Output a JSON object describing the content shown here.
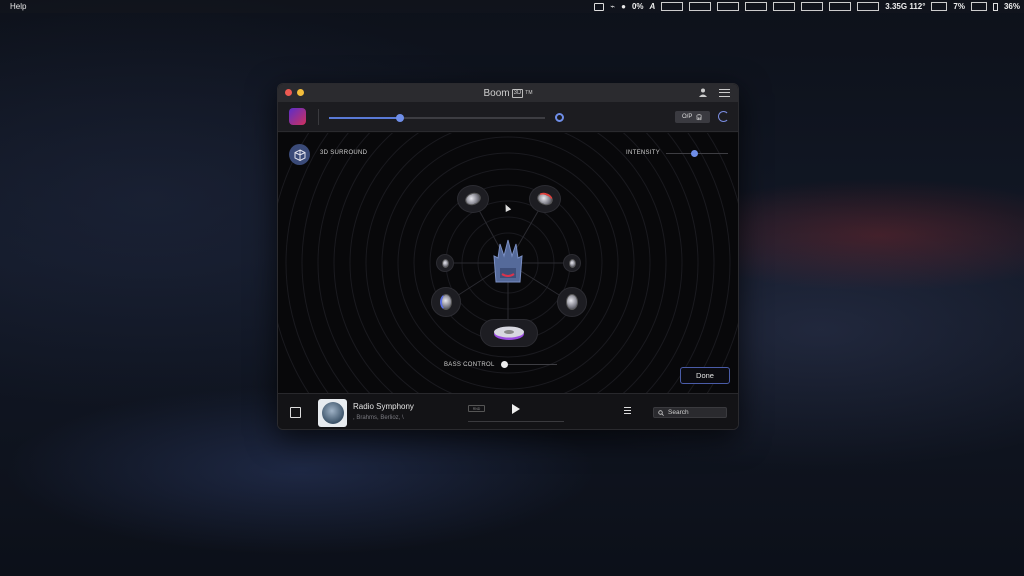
{
  "menubar": {
    "app_menu": "Help",
    "battery_label": "0%",
    "input_source": "A",
    "cpu_freq": "3.35G 112°",
    "cpu_usage": "7%",
    "battery_percent": "36%"
  },
  "window": {
    "title": "Boom",
    "title_badge": "3D",
    "trademark": "TM"
  },
  "toolbar": {
    "volume_level": 0.33,
    "output_button": "O/P"
  },
  "main": {
    "surround_label": "3D SURROUND",
    "intensity_label": "INTENSITY",
    "intensity_level": 0.45,
    "bass_label": "BASS CONTROL",
    "bass_level": 0.0,
    "done_button": "Done"
  },
  "player": {
    "track_title": "Radio Symphony",
    "track_artist": ", Brahms, Berlioz, \\",
    "random_label": "RND",
    "search_placeholder": "Search"
  },
  "colors": {
    "accent": "#6f8ee8",
    "close": "#ee5a52",
    "minimize": "#f3bd3b"
  }
}
